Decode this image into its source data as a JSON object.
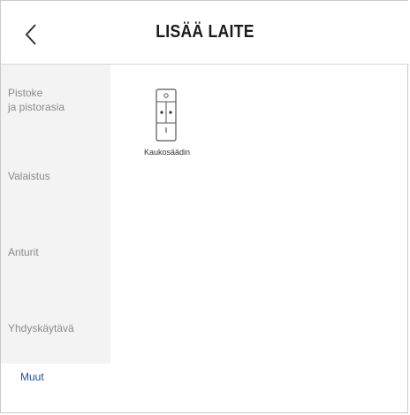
{
  "header": {
    "title": "LISÄÄ LAITE",
    "back_icon": "chevron-left-icon"
  },
  "sidebar": {
    "items": [
      {
        "label_line1": "Pistoke",
        "label_line2": "ja pistorasia"
      },
      {
        "label": "Valaistus"
      },
      {
        "label": "Anturit"
      },
      {
        "label": "Yhdyskäytävä"
      }
    ],
    "selected": {
      "label": "Muut"
    }
  },
  "devices": [
    {
      "label": "Kaukosäädin",
      "icon": "remote-control-icon"
    }
  ],
  "colors": {
    "accent": "#1f4fa0",
    "sidebar_bg": "#f3f3f3",
    "muted_text": "#8a8a8a"
  }
}
